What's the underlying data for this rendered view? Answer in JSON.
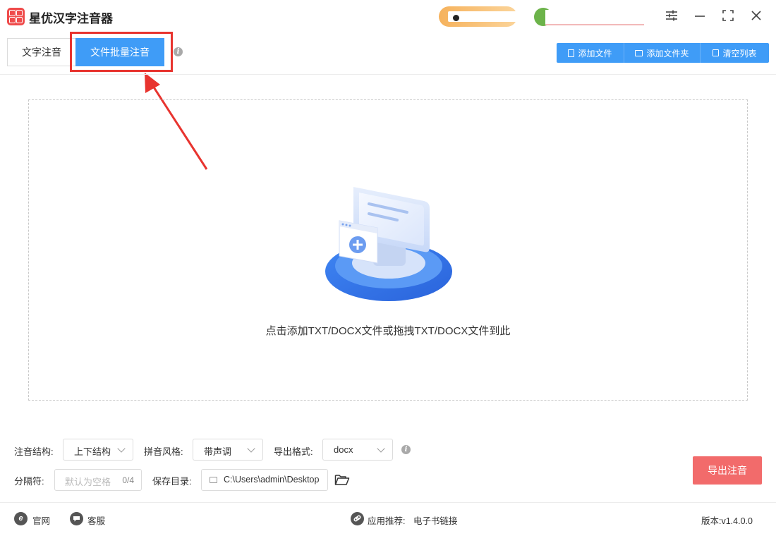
{
  "app": {
    "title": "星优汉字注音器"
  },
  "window": {
    "settings_icon": "sliders-icon",
    "minimize_icon": "minimize-icon",
    "maximize_icon": "maximize-icon",
    "close_icon": "close-icon"
  },
  "tabs": {
    "text_label": "文字注音",
    "batch_label": "文件批量注音"
  },
  "toolbar": {
    "add_file": "添加文件",
    "add_folder": "添加文件夹",
    "clear_list": "清空列表"
  },
  "dropzone": {
    "hint": "点击添加TXT/DOCX文件或拖拽TXT/DOCX文件到此"
  },
  "options": {
    "structure_label": "注音结构:",
    "structure_value": "上下结构",
    "style_label": "拼音风格:",
    "style_value": "带声调",
    "format_label": "导出格式:",
    "format_value": "docx",
    "separator_label": "分隔符:",
    "separator_placeholder": "默认为空格",
    "separator_count": "0/4",
    "save_dir_label": "保存目录:",
    "save_dir_value": "C:\\Users\\admin\\Desktop"
  },
  "export_button": "导出注音",
  "footer": {
    "website": "官网",
    "support": "客服",
    "recommend_label": "应用推荐:",
    "recommend_link": "电子书链接",
    "version": "版本:v1.4.0.0"
  },
  "colors": {
    "primary": "#3f9cf7",
    "export": "#f26b6b",
    "highlight": "#e8342f"
  }
}
